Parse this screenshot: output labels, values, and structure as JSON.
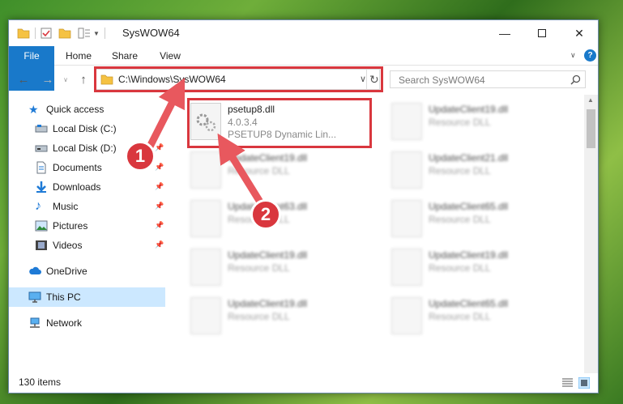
{
  "window": {
    "title": "SysWOW64"
  },
  "ribbon": {
    "file": "File",
    "home": "Home",
    "share": "Share",
    "view": "View"
  },
  "address": {
    "path": "C:\\Windows\\SysWOW64"
  },
  "search": {
    "placeholder": "Search SysWOW64"
  },
  "sidebar": {
    "items": [
      {
        "label": "Quick access"
      },
      {
        "label": "Local Disk (C:)"
      },
      {
        "label": "Local Disk (D:)"
      },
      {
        "label": "Documents"
      },
      {
        "label": "Downloads"
      },
      {
        "label": "Music"
      },
      {
        "label": "Pictures"
      },
      {
        "label": "Videos"
      },
      {
        "label": "OneDrive"
      },
      {
        "label": "This PC"
      },
      {
        "label": "Network"
      }
    ]
  },
  "files": {
    "main": {
      "name": "psetup8.dll",
      "version": "4.0.3.4",
      "desc": "PSETUP8 Dynamic Lin..."
    },
    "blurred": [
      {
        "name": "UpdateClient19.dll",
        "type": "Resource DLL"
      },
      {
        "name": "UpdateClient19.dll",
        "type": "Resource DLL"
      },
      {
        "name": "UpdateClient21.dll",
        "type": "Resource DLL"
      },
      {
        "name": "UpdateClient63.dll",
        "type": "Resource DLL"
      },
      {
        "name": "UpdateClient65.dll",
        "type": "Resource DLL"
      },
      {
        "name": "UpdateClient19.dll",
        "type": "Resource DLL"
      },
      {
        "name": "UpdateClient19.dll",
        "type": "Resource DLL"
      },
      {
        "name": "UpdateClient19.dll",
        "type": "Resource DLL"
      },
      {
        "name": "UpdateClient65.dll",
        "type": "Resource DLL"
      }
    ]
  },
  "status": {
    "count": "130 items"
  },
  "callouts": {
    "one": "1",
    "two": "2"
  },
  "colors": {
    "accent": "#1979ca",
    "highlight": "#d9373e",
    "selected": "#cce8ff"
  }
}
